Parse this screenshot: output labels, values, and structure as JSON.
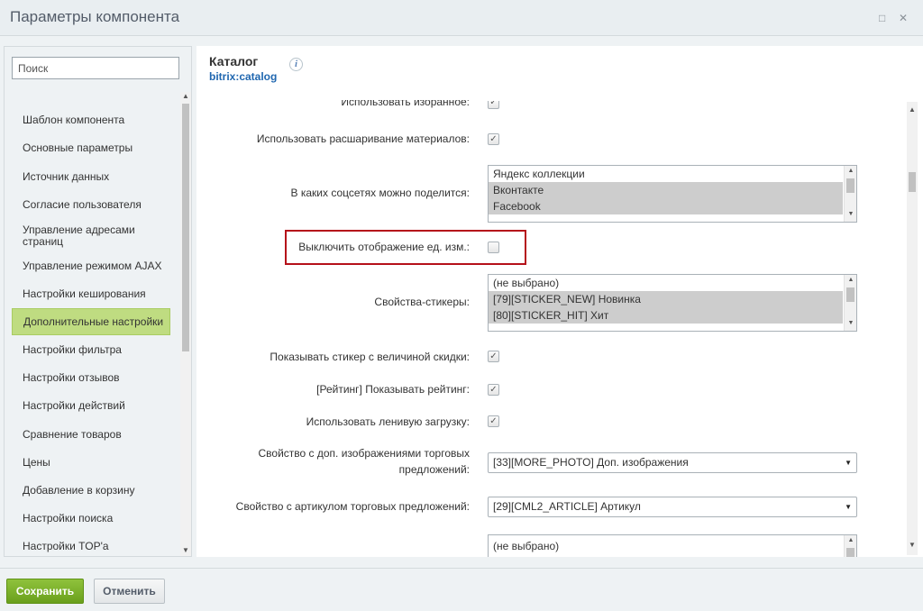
{
  "window": {
    "title": "Параметры компонента",
    "maximize_glyph": "□",
    "close_glyph": "✕"
  },
  "sidebar": {
    "search_placeholder": "Поиск",
    "items": [
      {
        "label": "Шаблон компонента"
      },
      {
        "label": "Основные параметры"
      },
      {
        "label": "Источник данных"
      },
      {
        "label": "Согласие пользователя"
      },
      {
        "label": "Управление адресами страниц"
      },
      {
        "label": "Управление режимом AJAX"
      },
      {
        "label": "Настройки кеширования"
      },
      {
        "label": "Дополнительные настройки",
        "active": true
      },
      {
        "label": "Настройки фильтра"
      },
      {
        "label": "Настройки отзывов"
      },
      {
        "label": "Настройки действий"
      },
      {
        "label": "Сравнение товаров"
      },
      {
        "label": "Цены"
      },
      {
        "label": "Добавление в корзину"
      },
      {
        "label": "Настройки поиска"
      },
      {
        "label": "Настройки TOP'а"
      }
    ]
  },
  "component": {
    "title": "Каталог",
    "code": "bitrix:catalog",
    "info_glyph": "i"
  },
  "params": {
    "use_favorites": {
      "label": "Использовать изоранное:",
      "checked": true
    },
    "use_share": {
      "label": "Использовать расшаривание материалов:",
      "checked": true
    },
    "share_networks": {
      "label": "В каких соцсетях можно поделится:",
      "options": [
        {
          "text": "Яндекс коллекции",
          "selected": false
        },
        {
          "text": "Вконтакте",
          "selected": true
        },
        {
          "text": "Facebook",
          "selected": true
        }
      ]
    },
    "hide_measure": {
      "label": "Выключить отображение ед. изм.:",
      "checked": false
    },
    "sticker_props": {
      "label": "Свойства-стикеры:",
      "options": [
        {
          "text": "(не выбрано)",
          "selected": false
        },
        {
          "text": "[79][STICKER_NEW] Новинка",
          "selected": true
        },
        {
          "text": "[80][STICKER_HIT] Хит",
          "selected": true
        }
      ]
    },
    "show_discount_sticker": {
      "label": "Показывать стикер с величиной скидки:",
      "checked": true
    },
    "show_rating": {
      "label": "[Рейтинг] Показывать рейтинг:",
      "checked": true
    },
    "lazy_load": {
      "label": "Использовать ленивую загрузку:",
      "checked": true
    },
    "offer_photo_prop": {
      "label_line1": "Свойство с доп. изображениями торговых",
      "label_line2": "предложений:",
      "value": "[33][MORE_PHOTO] Доп. изображения"
    },
    "offer_article_prop": {
      "label": "Свойство с артикулом торговых предложений:",
      "value": "[29][CML2_ARTICLE] Артикул"
    },
    "next_list": {
      "options": [
        {
          "text": "(не выбрано)",
          "selected": false
        }
      ]
    }
  },
  "glyphs": {
    "check": "✓",
    "arrow_up": "▲",
    "arrow_down": "▼"
  },
  "footer": {
    "save_label": "Сохранить",
    "cancel_label": "Отменить"
  },
  "colors": {
    "active_nav": "#bfdc81",
    "save_button": "#7db12a",
    "highlight_border": "#b5111a",
    "link_blue": "#2067b0"
  }
}
